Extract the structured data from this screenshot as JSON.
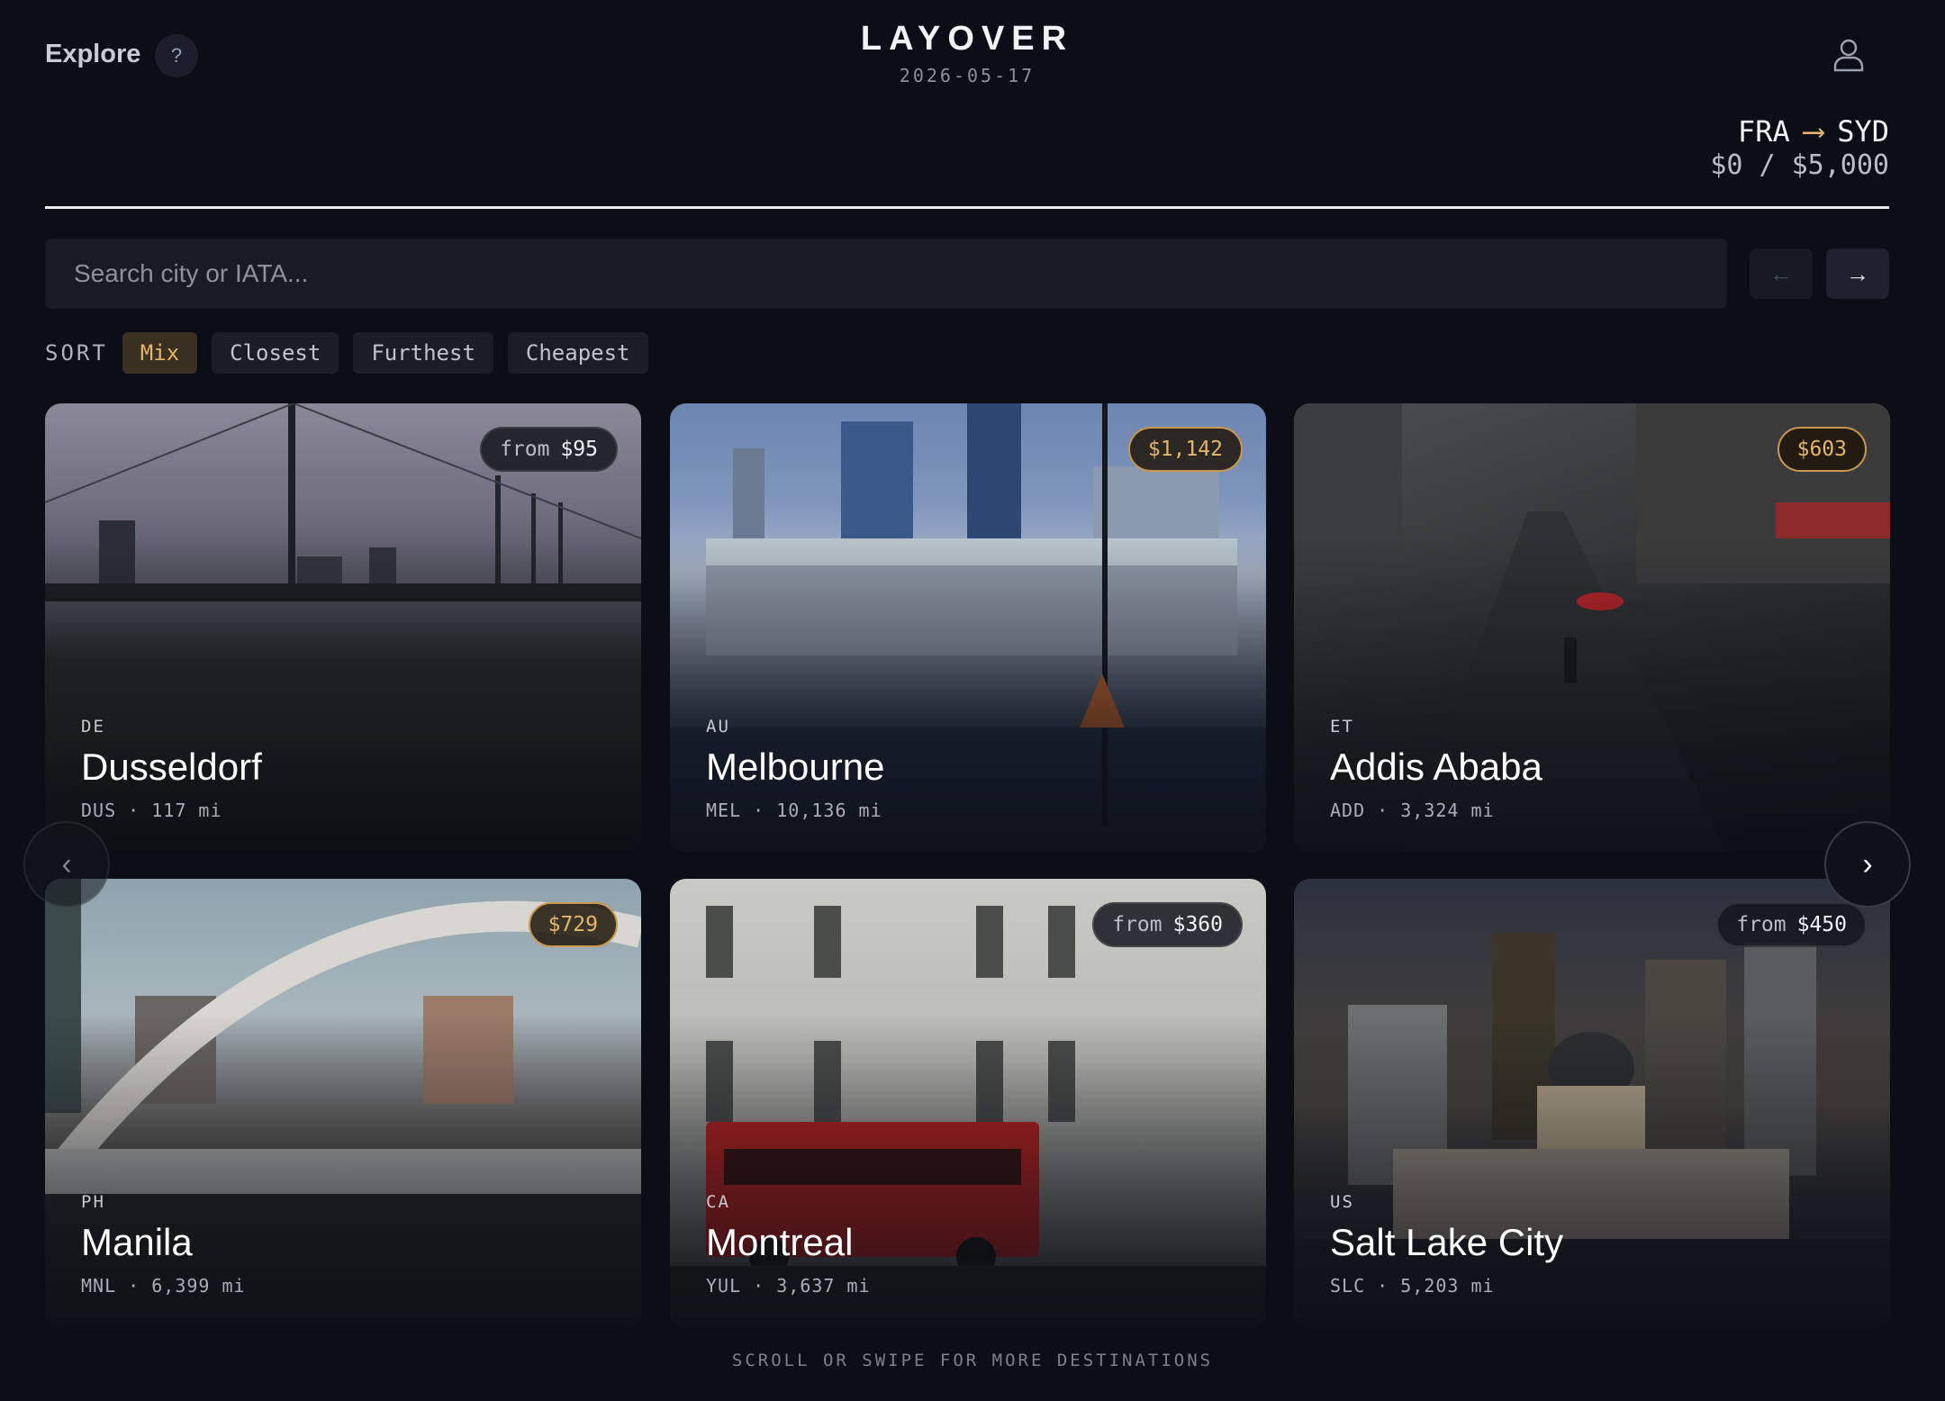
{
  "header": {
    "explore_label": "Explore",
    "help_label": "?",
    "brand": "LAYOVER",
    "date": "2026-05-17",
    "route_from": "FRA",
    "route_arrow": "⟶",
    "route_to": "SYD",
    "budget": "$0 / $5,000"
  },
  "search": {
    "placeholder": "Search city or IATA..."
  },
  "nav": {
    "prev": "←",
    "next": "→"
  },
  "sort": {
    "label": "SORT",
    "options": [
      "Mix",
      "Closest",
      "Furthest",
      "Cheapest"
    ],
    "active": "Mix"
  },
  "cards": [
    {
      "country": "DE",
      "city": "Dusseldorf",
      "iata": "DUS",
      "distance": "117 mi",
      "price_prefix": "from",
      "price": "$95",
      "deal": false
    },
    {
      "country": "AU",
      "city": "Melbourne",
      "iata": "MEL",
      "distance": "10,136 mi",
      "price_prefix": "",
      "price": "$1,142",
      "deal": true
    },
    {
      "country": "ET",
      "city": "Addis Ababa",
      "iata": "ADD",
      "distance": "3,324 mi",
      "price_prefix": "",
      "price": "$603",
      "deal": true
    },
    {
      "country": "PH",
      "city": "Manila",
      "iata": "MNL",
      "distance": "6,399 mi",
      "price_prefix": "",
      "price": "$729",
      "deal": true
    },
    {
      "country": "CA",
      "city": "Montreal",
      "iata": "YUL",
      "distance": "3,637 mi",
      "price_prefix": "from",
      "price": "$360",
      "deal": false
    },
    {
      "country": "US",
      "city": "Salt Lake City",
      "iata": "SLC",
      "distance": "5,203 mi",
      "price_prefix": "from",
      "price": "$450",
      "deal": false
    }
  ],
  "meta_separator": "·",
  "carousel": {
    "prev": "‹",
    "next": "›"
  },
  "footer": {
    "hint": "SCROLL OR SWIPE FOR MORE DESTINATIONS"
  },
  "colors": {
    "background": "#0b0e17",
    "accent": "#e5b56c",
    "surface": "#181b26"
  },
  "icons": {
    "user": "user-icon",
    "help": "question-icon"
  }
}
